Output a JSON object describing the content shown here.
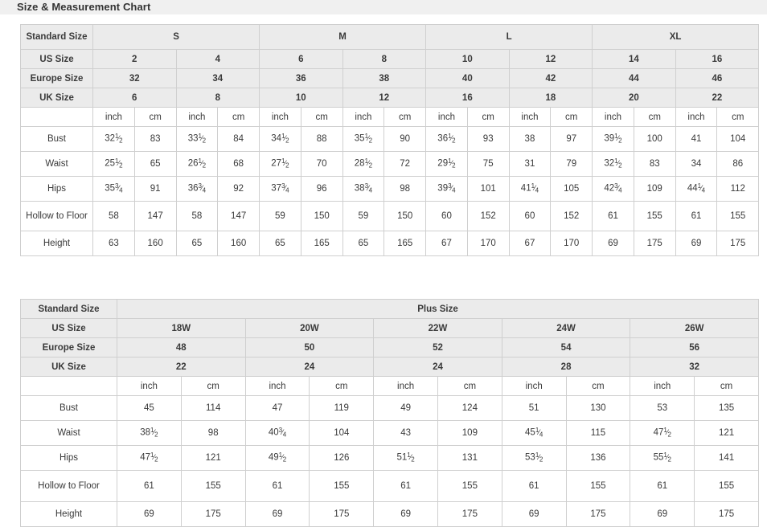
{
  "header": {
    "title": "Size & Measurement Chart"
  },
  "standard_chart": {
    "corner_label": "Standard Size",
    "size_groups": [
      {
        "label": "S",
        "span": 2
      },
      {
        "label": "M",
        "span": 2
      },
      {
        "label": "L",
        "span": 2
      },
      {
        "label": "XL",
        "span": 2
      }
    ],
    "rows": [
      {
        "label": "US Size",
        "values": [
          "2",
          "4",
          "6",
          "8",
          "10",
          "12",
          "14",
          "16"
        ]
      },
      {
        "label": "Europe Size",
        "values": [
          "32",
          "34",
          "36",
          "38",
          "40",
          "42",
          "44",
          "46"
        ]
      },
      {
        "label": "UK Size",
        "values": [
          "6",
          "8",
          "10",
          "12",
          "16",
          "18",
          "20",
          "22"
        ]
      }
    ],
    "unit_row": {
      "label": "",
      "units": [
        "inch",
        "cm",
        "inch",
        "cm",
        "inch",
        "cm",
        "inch",
        "cm",
        "inch",
        "cm",
        "inch",
        "cm",
        "inch",
        "cm",
        "inch",
        "cm"
      ]
    },
    "measurements": [
      {
        "label": "Bust",
        "cells": [
          {
            "whole": "32",
            "num": "1",
            "den": "2"
          },
          {
            "whole": "83"
          },
          {
            "whole": "33",
            "num": "1",
            "den": "2"
          },
          {
            "whole": "84"
          },
          {
            "whole": "34",
            "num": "1",
            "den": "2"
          },
          {
            "whole": "88"
          },
          {
            "whole": "35",
            "num": "1",
            "den": "2"
          },
          {
            "whole": "90"
          },
          {
            "whole": "36",
            "num": "1",
            "den": "2"
          },
          {
            "whole": "93"
          },
          {
            "whole": "38"
          },
          {
            "whole": "97"
          },
          {
            "whole": "39",
            "num": "1",
            "den": "2"
          },
          {
            "whole": "100"
          },
          {
            "whole": "41"
          },
          {
            "whole": "104"
          }
        ]
      },
      {
        "label": "Waist",
        "cells": [
          {
            "whole": "25",
            "num": "1",
            "den": "2"
          },
          {
            "whole": "65"
          },
          {
            "whole": "26",
            "num": "1",
            "den": "2"
          },
          {
            "whole": "68"
          },
          {
            "whole": "27",
            "num": "1",
            "den": "2"
          },
          {
            "whole": "70"
          },
          {
            "whole": "28",
            "num": "1",
            "den": "2"
          },
          {
            "whole": "72"
          },
          {
            "whole": "29",
            "num": "1",
            "den": "2"
          },
          {
            "whole": "75"
          },
          {
            "whole": "31"
          },
          {
            "whole": "79"
          },
          {
            "whole": "32",
            "num": "1",
            "den": "2"
          },
          {
            "whole": "83"
          },
          {
            "whole": "34"
          },
          {
            "whole": "86"
          }
        ]
      },
      {
        "label": "Hips",
        "cells": [
          {
            "whole": "35",
            "num": "3",
            "den": "4"
          },
          {
            "whole": "91"
          },
          {
            "whole": "36",
            "num": "3",
            "den": "4"
          },
          {
            "whole": "92"
          },
          {
            "whole": "37",
            "num": "3",
            "den": "4"
          },
          {
            "whole": "96"
          },
          {
            "whole": "38",
            "num": "3",
            "den": "4"
          },
          {
            "whole": "98"
          },
          {
            "whole": "39",
            "num": "3",
            "den": "4"
          },
          {
            "whole": "101"
          },
          {
            "whole": "41",
            "num": "1",
            "den": "4"
          },
          {
            "whole": "105"
          },
          {
            "whole": "42",
            "num": "3",
            "den": "4"
          },
          {
            "whole": "109"
          },
          {
            "whole": "44",
            "num": "1",
            "den": "4"
          },
          {
            "whole": "112"
          }
        ]
      },
      {
        "label": "Hollow to Floor",
        "cells": [
          {
            "whole": "58"
          },
          {
            "whole": "147"
          },
          {
            "whole": "58"
          },
          {
            "whole": "147"
          },
          {
            "whole": "59"
          },
          {
            "whole": "150"
          },
          {
            "whole": "59"
          },
          {
            "whole": "150"
          },
          {
            "whole": "60"
          },
          {
            "whole": "152"
          },
          {
            "whole": "60"
          },
          {
            "whole": "152"
          },
          {
            "whole": "61"
          },
          {
            "whole": "155"
          },
          {
            "whole": "61"
          },
          {
            "whole": "155"
          }
        ]
      },
      {
        "label": "Height",
        "cells": [
          {
            "whole": "63"
          },
          {
            "whole": "160"
          },
          {
            "whole": "65"
          },
          {
            "whole": "160"
          },
          {
            "whole": "65"
          },
          {
            "whole": "165"
          },
          {
            "whole": "65"
          },
          {
            "whole": "165"
          },
          {
            "whole": "67"
          },
          {
            "whole": "170"
          },
          {
            "whole": "67"
          },
          {
            "whole": "170"
          },
          {
            "whole": "69"
          },
          {
            "whole": "175"
          },
          {
            "whole": "69"
          },
          {
            "whole": "175"
          }
        ]
      }
    ]
  },
  "plus_chart": {
    "corner_label": "Standard Size",
    "group_label": "Plus Size",
    "rows": [
      {
        "label": "US Size",
        "values": [
          "18W",
          "20W",
          "22W",
          "24W",
          "26W"
        ]
      },
      {
        "label": "Europe Size",
        "values": [
          "48",
          "50",
          "52",
          "54",
          "56"
        ]
      },
      {
        "label": "UK Size",
        "values": [
          "22",
          "24",
          "24",
          "28",
          "32"
        ]
      }
    ],
    "unit_row": {
      "label": "",
      "units": [
        "inch",
        "cm",
        "inch",
        "cm",
        "inch",
        "cm",
        "inch",
        "cm",
        "inch",
        "cm"
      ]
    },
    "measurements": [
      {
        "label": "Bust",
        "cells": [
          {
            "whole": "45"
          },
          {
            "whole": "114"
          },
          {
            "whole": "47"
          },
          {
            "whole": "119"
          },
          {
            "whole": "49"
          },
          {
            "whole": "124"
          },
          {
            "whole": "51"
          },
          {
            "whole": "130"
          },
          {
            "whole": "53"
          },
          {
            "whole": "135"
          }
        ]
      },
      {
        "label": "Waist",
        "cells": [
          {
            "whole": "38",
            "num": "1",
            "den": "2"
          },
          {
            "whole": "98"
          },
          {
            "whole": "40",
            "num": "3",
            "den": "4"
          },
          {
            "whole": "104"
          },
          {
            "whole": "43"
          },
          {
            "whole": "109"
          },
          {
            "whole": "45",
            "num": "1",
            "den": "4"
          },
          {
            "whole": "115"
          },
          {
            "whole": "47",
            "num": "1",
            "den": "2"
          },
          {
            "whole": "121"
          }
        ]
      },
      {
        "label": "Hips",
        "cells": [
          {
            "whole": "47",
            "num": "1",
            "den": "2"
          },
          {
            "whole": "121"
          },
          {
            "whole": "49",
            "num": "1",
            "den": "2"
          },
          {
            "whole": "126"
          },
          {
            "whole": "51",
            "num": "1",
            "den": "2"
          },
          {
            "whole": "131"
          },
          {
            "whole": "53",
            "num": "1",
            "den": "2"
          },
          {
            "whole": "136"
          },
          {
            "whole": "55",
            "num": "1",
            "den": "2"
          },
          {
            "whole": "141"
          }
        ]
      },
      {
        "label": "Hollow to Floor",
        "cells": [
          {
            "whole": "61"
          },
          {
            "whole": "155"
          },
          {
            "whole": "61"
          },
          {
            "whole": "155"
          },
          {
            "whole": "61"
          },
          {
            "whole": "155"
          },
          {
            "whole": "61"
          },
          {
            "whole": "155"
          },
          {
            "whole": "61"
          },
          {
            "whole": "155"
          }
        ]
      },
      {
        "label": "Height",
        "cells": [
          {
            "whole": "69"
          },
          {
            "whole": "175"
          },
          {
            "whole": "69"
          },
          {
            "whole": "175"
          },
          {
            "whole": "69"
          },
          {
            "whole": "175"
          },
          {
            "whole": "69"
          },
          {
            "whole": "175"
          },
          {
            "whole": "69"
          },
          {
            "whole": "175"
          }
        ]
      }
    ]
  },
  "colors": {
    "title_band_bg": "#f0f0f0",
    "header_cell_bg": "#ebebeb",
    "border": "#cfcfcf",
    "text": "#333333"
  }
}
